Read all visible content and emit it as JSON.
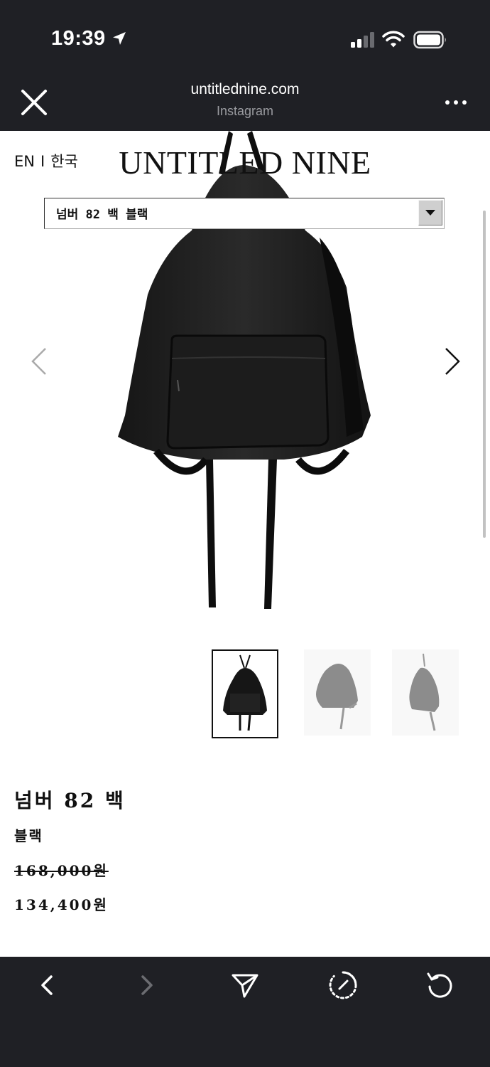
{
  "status_bar": {
    "time": "19:39",
    "icons": [
      "location-arrow-icon",
      "cellular-signal-icon",
      "wifi-icon",
      "battery-icon"
    ]
  },
  "browser": {
    "url": "untitlednine.com",
    "source": "Instagram",
    "close_icon": "close-icon",
    "more_icon": "more-icon"
  },
  "site": {
    "lang": {
      "en": "EN",
      "separator": "I",
      "ko": "한국"
    },
    "brand": "UNTITLED NINE",
    "variant_select": {
      "selected": "넘버 82 백 블랙"
    }
  },
  "gallery": {
    "prev_icon": "chevron-left-icon",
    "next_icon": "chevron-right-icon",
    "thumbnails": 3,
    "active_index": 0
  },
  "product": {
    "name": "넘버 82 백",
    "color": "블랙",
    "price_original": "168,000원",
    "price_sale": "134,400원"
  },
  "toolbar": {
    "icons": [
      "back-icon",
      "forward-icon",
      "share-icon",
      "speed-icon",
      "reload-icon"
    ]
  },
  "colors": {
    "chrome_background": "#1f2025",
    "page_background": "#ffffff",
    "text": "#111111",
    "muted": "#9a9ba0"
  }
}
